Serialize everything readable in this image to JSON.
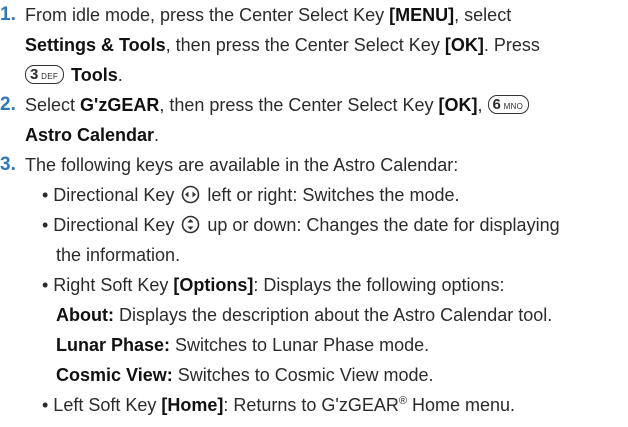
{
  "steps": [
    {
      "number": "1.",
      "lines": [
        [
          "From idle mode, press the Center Select Key ",
          "[MENU]",
          ", select"
        ],
        [
          "Settings & Tools",
          ", then press the Center Select Key ",
          "[OK]",
          ". Press"
        ],
        [
          "Tools",
          "."
        ]
      ],
      "key": {
        "digit": "3",
        "letters": "DEF"
      }
    },
    {
      "number": "2.",
      "lines": [
        [
          "Select ",
          "G'zGEAR",
          ", then press the Center Select Key ",
          "[OK]",
          ","
        ],
        [
          "Astro Calendar",
          "."
        ]
      ],
      "key": {
        "digit": "6",
        "letters": "MNO"
      }
    },
    {
      "number": "3.",
      "lines": [
        [
          "The following keys are available in the Astro Calendar:"
        ]
      ]
    }
  ],
  "bullets": {
    "b1": [
      "• Directional Key ",
      " left or right: Switches the mode."
    ],
    "b2": [
      "• Directional Key ",
      " up or down: Changes the date for displaying"
    ],
    "b2_cont": "the information.",
    "b3": [
      "• Right Soft Key ",
      "[Options]",
      ": Displays the following options:"
    ],
    "opt1": [
      "About:",
      " Displays the description about the Astro Calendar tool."
    ],
    "opt2": [
      "Lunar Phase:",
      " Switches to Lunar Phase mode."
    ],
    "opt3": [
      "Cosmic View:",
      " Switches to Cosmic View mode."
    ],
    "b4": [
      "• Left Soft Key ",
      "[Home]",
      ": Returns to G'zGEAR",
      "®",
      " Home menu."
    ]
  },
  "icons": {
    "lr": "directional-left-right-icon",
    "ud": "directional-up-down-icon"
  }
}
